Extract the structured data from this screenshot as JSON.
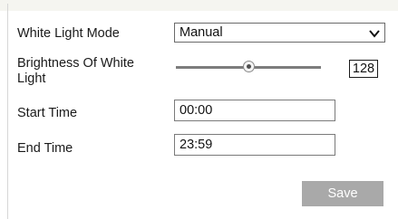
{
  "form": {
    "white_light_mode": {
      "label": "White Light Mode",
      "value": "Manual"
    },
    "brightness": {
      "label_line1": "Brightness Of White",
      "label_line2": "Light",
      "value": "128",
      "fraction": 0.5
    },
    "start_time": {
      "label": "Start Time",
      "value": "00:00"
    },
    "end_time": {
      "label": "End Time",
      "value": "23:59"
    }
  },
  "actions": {
    "save_label": "Save"
  },
  "icons": {
    "select_arrow": "chevron-down-icon"
  },
  "colors": {
    "button": "#a9a9a9",
    "button_text": "#ffffff"
  }
}
